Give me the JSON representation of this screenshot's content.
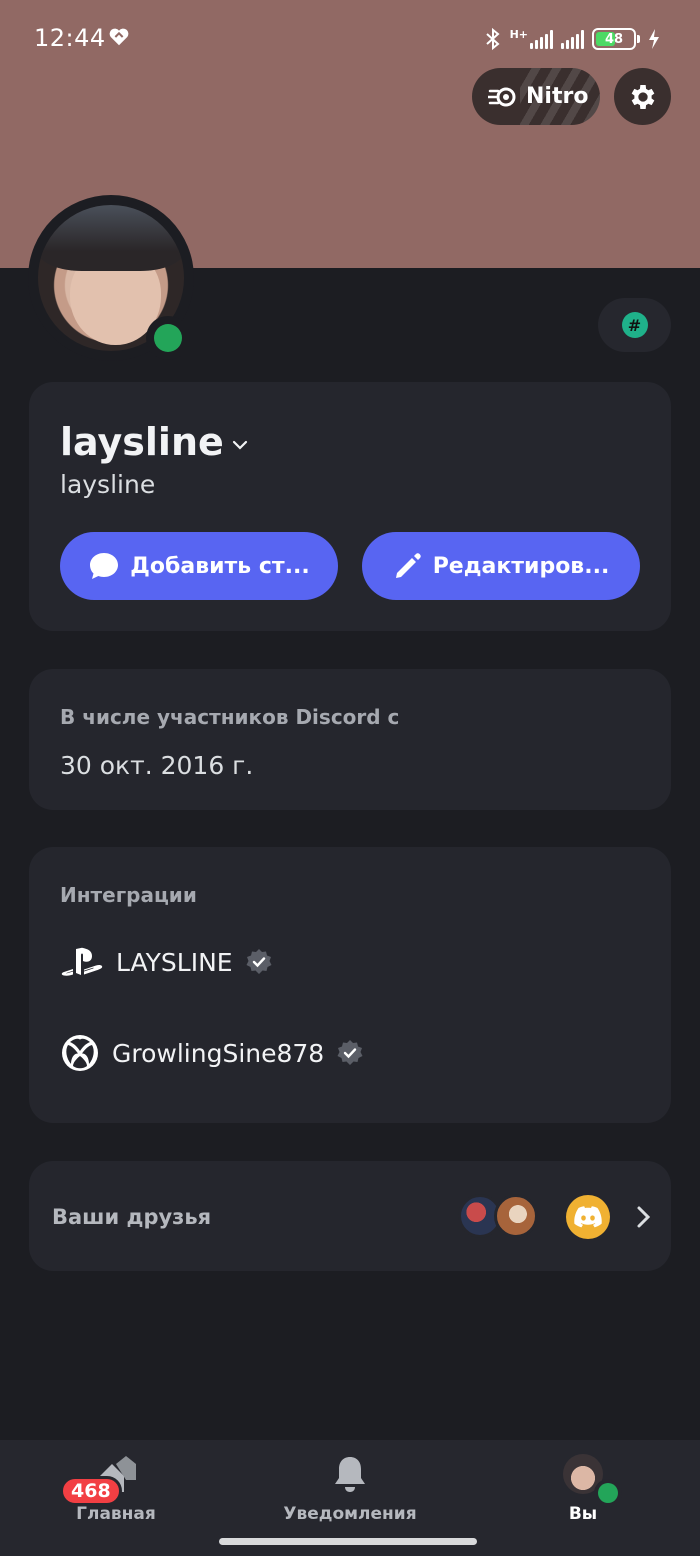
{
  "status_bar": {
    "time": "12:44",
    "network": "H+",
    "battery": "48"
  },
  "header": {
    "nitro_label": "Nitro"
  },
  "profile": {
    "display_name": "laysline",
    "username": "laysline",
    "status_button": "Добавить ст...",
    "edit_button": "Редактиров..."
  },
  "member_since": {
    "label": "В числе участников Discord с",
    "date": "30 окт. 2016 г."
  },
  "integrations": {
    "title": "Интеграции",
    "items": [
      {
        "platform": "playstation",
        "name": "LAYSLINE"
      },
      {
        "platform": "xbox",
        "name": "GrowlingSine878"
      }
    ]
  },
  "friends": {
    "label": "Ваши друзья"
  },
  "bottom_nav": {
    "home_label": "Главная",
    "home_badge": "468",
    "notifications_label": "Уведомления",
    "you_label": "Вы"
  },
  "colors": {
    "banner": "#916964",
    "background": "#1c1d22",
    "card": "#25262d",
    "accent": "#5865f2",
    "online": "#23a559",
    "badge": "#f23f43"
  }
}
